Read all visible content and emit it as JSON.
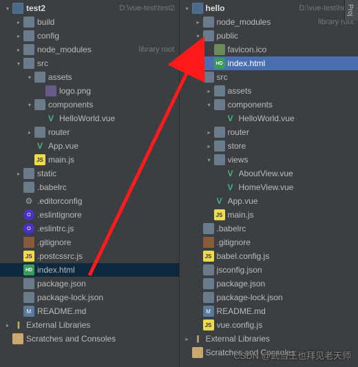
{
  "watermark": "CSDN @武当王也拜见老天师",
  "tab": "Proj",
  "panels": [
    {
      "name": "left-tree",
      "items": [
        {
          "depth": 0,
          "arrow": "down",
          "icon": "module",
          "label": "test2",
          "bold": true,
          "hint": "D:\\vue-test\\test2",
          "interact": true
        },
        {
          "depth": 1,
          "arrow": "right",
          "icon": "folder",
          "label": "build",
          "interact": true
        },
        {
          "depth": 1,
          "arrow": "right",
          "icon": "folder",
          "label": "config",
          "interact": true
        },
        {
          "depth": 1,
          "arrow": "right",
          "icon": "folder",
          "label": "node_modules",
          "hint": "library root",
          "interact": true
        },
        {
          "depth": 1,
          "arrow": "down",
          "icon": "folder",
          "label": "src",
          "interact": true
        },
        {
          "depth": 2,
          "arrow": "down",
          "icon": "folder",
          "label": "assets",
          "interact": true
        },
        {
          "depth": 3,
          "arrow": "none",
          "icon": "img",
          "label": "logo.png",
          "interact": true
        },
        {
          "depth": 2,
          "arrow": "down",
          "icon": "folder",
          "label": "components",
          "interact": true
        },
        {
          "depth": 3,
          "arrow": "none",
          "icon": "vue",
          "label": "HelloWorld.vue",
          "interact": true
        },
        {
          "depth": 2,
          "arrow": "right",
          "icon": "folder",
          "label": "router",
          "interact": true
        },
        {
          "depth": 2,
          "arrow": "none",
          "icon": "vue",
          "label": "App.vue",
          "interact": true
        },
        {
          "depth": 2,
          "arrow": "none",
          "icon": "js",
          "label": "main.js",
          "interact": true
        },
        {
          "depth": 1,
          "arrow": "right",
          "icon": "folder",
          "label": "static",
          "interact": true
        },
        {
          "depth": 1,
          "arrow": "none",
          "icon": "json",
          "label": ".babelrc",
          "interact": true
        },
        {
          "depth": 1,
          "arrow": "none",
          "icon": "gear",
          "label": ".editorconfig",
          "interact": true
        },
        {
          "depth": 1,
          "arrow": "none",
          "icon": "eslint",
          "label": ".eslintignore",
          "interact": true
        },
        {
          "depth": 1,
          "arrow": "none",
          "icon": "eslint",
          "label": ".eslintrc.js",
          "interact": true
        },
        {
          "depth": 1,
          "arrow": "none",
          "icon": "git",
          "label": ".gitignore",
          "interact": true
        },
        {
          "depth": 1,
          "arrow": "none",
          "icon": "js",
          "label": ".postcssrc.js",
          "interact": true
        },
        {
          "depth": 1,
          "arrow": "none",
          "icon": "html",
          "label": "index.html",
          "interact": true,
          "selected": true
        },
        {
          "depth": 1,
          "arrow": "none",
          "icon": "json",
          "label": "package.json",
          "interact": true
        },
        {
          "depth": 1,
          "arrow": "none",
          "icon": "json",
          "label": "package-lock.json",
          "interact": true
        },
        {
          "depth": 1,
          "arrow": "none",
          "icon": "md",
          "label": "README.md",
          "interact": true
        },
        {
          "depth": 0,
          "arrow": "right",
          "icon": "lib",
          "label": "External Libraries",
          "interact": true
        },
        {
          "depth": 0,
          "arrow": "none",
          "icon": "scratch",
          "label": "Scratches and Consoles",
          "interact": true
        }
      ]
    },
    {
      "name": "right-tree",
      "items": [
        {
          "depth": 0,
          "arrow": "down",
          "icon": "module",
          "label": "hello",
          "bold": true,
          "hint": "D:\\vue-test\\hello",
          "interact": true
        },
        {
          "depth": 1,
          "arrow": "right",
          "icon": "folder",
          "label": "node_modules",
          "hint": "library root",
          "interact": true
        },
        {
          "depth": 1,
          "arrow": "down",
          "icon": "folder",
          "label": "public",
          "interact": true
        },
        {
          "depth": 2,
          "arrow": "none",
          "icon": "ico",
          "label": "favicon.ico",
          "interact": true
        },
        {
          "depth": 2,
          "arrow": "none",
          "icon": "html",
          "label": "index.html",
          "interact": true,
          "highlight": true
        },
        {
          "depth": 1,
          "arrow": "down",
          "icon": "folder",
          "label": "src",
          "interact": true
        },
        {
          "depth": 2,
          "arrow": "right",
          "icon": "folder",
          "label": "assets",
          "interact": true
        },
        {
          "depth": 2,
          "arrow": "down",
          "icon": "folder",
          "label": "components",
          "interact": true
        },
        {
          "depth": 3,
          "arrow": "none",
          "icon": "vue",
          "label": "HelloWorld.vue",
          "interact": true
        },
        {
          "depth": 2,
          "arrow": "right",
          "icon": "folder",
          "label": "router",
          "interact": true
        },
        {
          "depth": 2,
          "arrow": "right",
          "icon": "folder",
          "label": "store",
          "interact": true
        },
        {
          "depth": 2,
          "arrow": "down",
          "icon": "folder",
          "label": "views",
          "interact": true
        },
        {
          "depth": 3,
          "arrow": "none",
          "icon": "vue",
          "label": "AboutView.vue",
          "interact": true
        },
        {
          "depth": 3,
          "arrow": "none",
          "icon": "vue",
          "label": "HomeView.vue",
          "interact": true
        },
        {
          "depth": 2,
          "arrow": "none",
          "icon": "vue",
          "label": "App.vue",
          "interact": true
        },
        {
          "depth": 2,
          "arrow": "none",
          "icon": "js",
          "label": "main.js",
          "interact": true
        },
        {
          "depth": 1,
          "arrow": "none",
          "icon": "json",
          "label": ".babelrc",
          "interact": true
        },
        {
          "depth": 1,
          "arrow": "none",
          "icon": "git",
          "label": ".gitignore",
          "interact": true
        },
        {
          "depth": 1,
          "arrow": "none",
          "icon": "js",
          "label": "babel.config.js",
          "interact": true
        },
        {
          "depth": 1,
          "arrow": "none",
          "icon": "json",
          "label": "jsconfig.json",
          "interact": true
        },
        {
          "depth": 1,
          "arrow": "none",
          "icon": "json",
          "label": "package.json",
          "interact": true
        },
        {
          "depth": 1,
          "arrow": "none",
          "icon": "json",
          "label": "package-lock.json",
          "interact": true
        },
        {
          "depth": 1,
          "arrow": "none",
          "icon": "md",
          "label": "README.md",
          "interact": true
        },
        {
          "depth": 1,
          "arrow": "none",
          "icon": "js",
          "label": "vue.config.js",
          "interact": true
        },
        {
          "depth": 0,
          "arrow": "right",
          "icon": "lib",
          "label": "External Libraries",
          "interact": true
        },
        {
          "depth": 0,
          "arrow": "none",
          "icon": "scratch",
          "label": "Scratches and Consoles",
          "interact": true
        }
      ]
    }
  ]
}
